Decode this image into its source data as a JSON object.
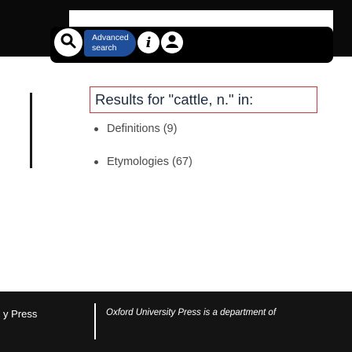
{
  "header": {
    "advanced_search": [
      "Advanced",
      "search"
    ],
    "colors": {
      "bar": "#000000",
      "pill": "#1f4f9a"
    }
  },
  "results": {
    "title": "Results for \"cattle, n.\" in:",
    "items": [
      {
        "label": "Definitions (9)"
      },
      {
        "label": "Etymologies (67)"
      }
    ]
  },
  "footer": {
    "press_label": "y Press",
    "note": "Oxford University Press is a department of"
  }
}
